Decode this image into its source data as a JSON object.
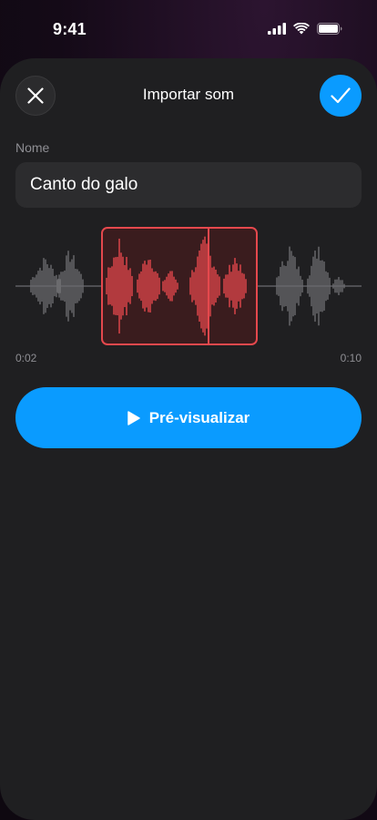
{
  "status_bar": {
    "time": "9:41",
    "icons": [
      "cellular-signal-icon",
      "wifi-icon",
      "battery-icon"
    ]
  },
  "header": {
    "title": "Importar som",
    "close_icon": "close-icon",
    "confirm_icon": "checkmark-icon"
  },
  "name_field": {
    "label": "Nome",
    "value": "Canto do galo"
  },
  "trimmer": {
    "start_time": "0:02",
    "end_time": "0:10",
    "selection_color": "#e5484d"
  },
  "preview_button": {
    "label": "Pré-visualizar",
    "icon": "play-icon"
  },
  "colors": {
    "accent": "#0a9bff",
    "sheet": "#1f1f21",
    "field": "#2c2c2e",
    "waveform_inactive": "#6b6b6f",
    "waveform_selected": "#e5484d"
  }
}
